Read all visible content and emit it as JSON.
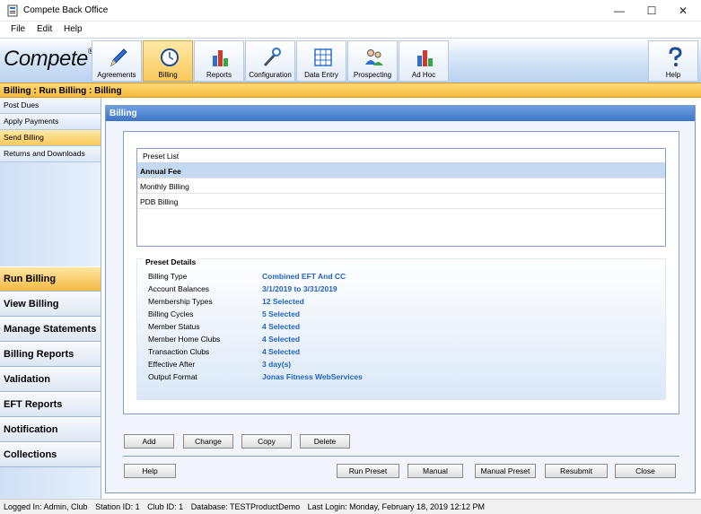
{
  "window": {
    "title": "Compete Back Office",
    "minimize": "—",
    "maximize": "☐",
    "close": "✕"
  },
  "menu": [
    "File",
    "Edit",
    "Help"
  ],
  "logo": {
    "text": "Compete",
    "mark": "®"
  },
  "toolbar": {
    "buttons": [
      {
        "label": "Agreements",
        "icon": "pencil-icon"
      },
      {
        "label": "Billing",
        "icon": "clock-icon",
        "active": true
      },
      {
        "label": "Reports",
        "icon": "bar-chart-icon"
      },
      {
        "label": "Configuration",
        "icon": "wrench-icon"
      },
      {
        "label": "Data Entry",
        "icon": "grid-icon"
      },
      {
        "label": "Prospecting",
        "icon": "people-icon"
      },
      {
        "label": "Ad Hoc",
        "icon": "bar-chart-icon"
      }
    ],
    "help_label": "Help"
  },
  "breadcrumb": "Billing : Run Billing : Billing",
  "leftnav": {
    "sub_items": [
      "Post Dues",
      "Apply Payments",
      "Send Billing",
      "Returns and Downloads"
    ],
    "active_sub": "Send Billing",
    "items": [
      "Run Billing",
      "View Billing",
      "Manage Statements",
      "Billing Reports",
      "Validation",
      "EFT Reports",
      "Notification",
      "Collections"
    ],
    "active_item": "Run Billing"
  },
  "main": {
    "title": "Billing",
    "preset_list": {
      "header": "Preset List",
      "rows": [
        "Annual Fee",
        "Monthly Billing",
        "PDB Billing"
      ],
      "selected": "Annual Fee"
    },
    "details": {
      "title": "Preset Details",
      "rows": [
        {
          "label": "Billing Type",
          "value": "Combined EFT And CC"
        },
        {
          "label": "Account Balances",
          "value": "3/1/2019 to 3/31/2019"
        },
        {
          "label": "Membership Types",
          "value": "12 Selected"
        },
        {
          "label": "Billing Cycles",
          "value": "5 Selected"
        },
        {
          "label": "Member Status",
          "value": "4 Selected"
        },
        {
          "label": "Member Home Clubs",
          "value": "4 Selected"
        },
        {
          "label": "Transaction Clubs",
          "value": "4 Selected"
        },
        {
          "label": "Effective After",
          "value": "3 day(s)"
        },
        {
          "label": "Output Format",
          "value": "Jonas Fitness WebServices"
        }
      ]
    },
    "buttons": {
      "add": "Add",
      "change": "Change",
      "copy": "Copy",
      "delete": "Delete",
      "help": "Help",
      "run_preset": "Run Preset",
      "manual": "Manual",
      "manual_preset": "Manual Preset",
      "resubmit": "Resubmit",
      "close": "Close"
    }
  },
  "status": {
    "logged_in": "Logged In: Admin, Club",
    "station": "Station ID: 1",
    "club": "Club ID: 1",
    "database": "Database: TESTProductDemo",
    "last_login": "Last Login: Monday, February 18, 2019 12:12 PM"
  },
  "colors": {
    "accent": "#3d74c8",
    "highlight": "#f9c95c",
    "value_text": "#1f63c4"
  }
}
